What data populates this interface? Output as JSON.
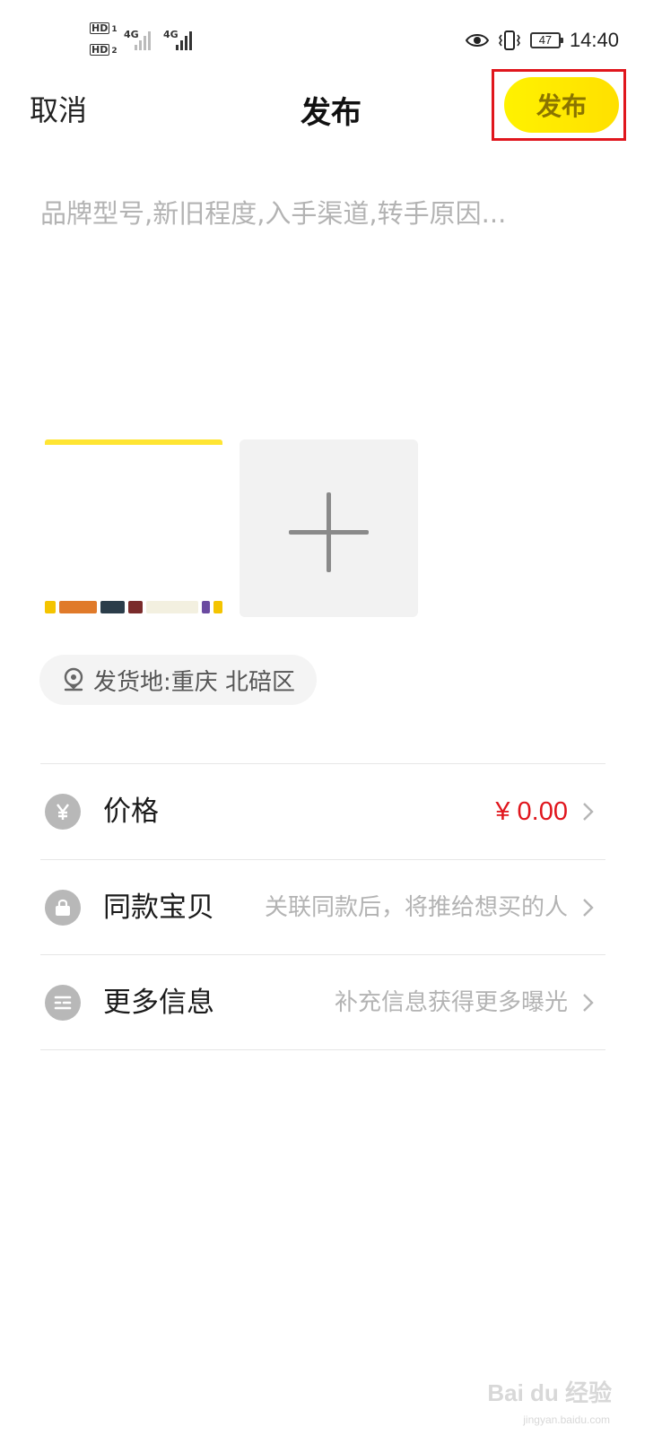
{
  "status_bar": {
    "sim1": "HD",
    "sim1_num": "1",
    "sim2": "HD",
    "sim2_num": "2",
    "net1": "4G",
    "net2": "4G",
    "battery": "47",
    "time": "14:40"
  },
  "header": {
    "cancel_label": "取消",
    "title": "发布",
    "publish_label": "发布"
  },
  "description": {
    "placeholder": "品牌型号,新旧程度,入手渠道,转手原因...",
    "value": ""
  },
  "photos": {
    "add_icon": "plus-icon"
  },
  "location": {
    "icon": "location-pin-icon",
    "label": "发货地:重庆 北碚区"
  },
  "rows": [
    {
      "label": "价格",
      "value": "¥ 0.00",
      "icon": "yen-icon"
    },
    {
      "label": "同款宝贝",
      "value": "关联同款后，将推给想买的人",
      "icon": "lock-bag-icon"
    },
    {
      "label": "更多信息",
      "value": "补充信息获得更多曝光",
      "icon": "list-icon"
    }
  ],
  "watermark": {
    "text": "Bai du 经验",
    "sub": "jingyan.baidu.com"
  },
  "colors": {
    "publish_button": "#ffe800",
    "price": "#e0161d",
    "highlight_box": "#e0161d"
  }
}
